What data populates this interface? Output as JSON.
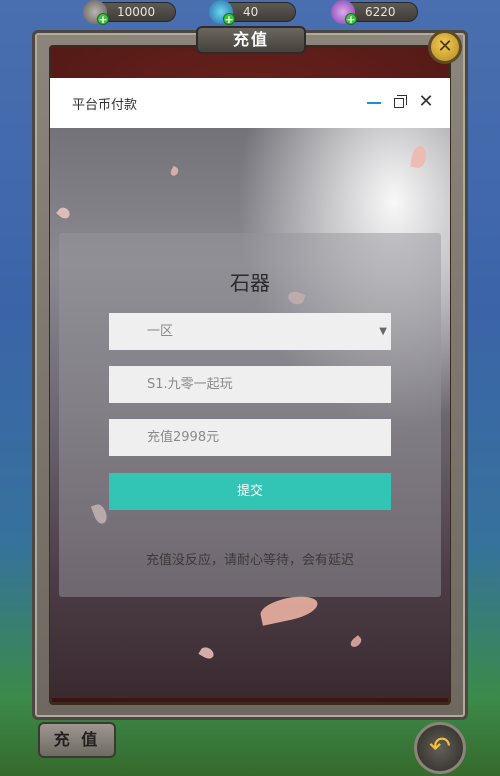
{
  "resources": {
    "gold": "10000",
    "gems": "40",
    "crystals": "6220"
  },
  "game": {
    "panel_title": "充值",
    "bottom_button": "充 值",
    "close_icon": "close-x-icon",
    "back_icon": "back-arrow-icon"
  },
  "dialog": {
    "title": "平台币付款",
    "card_title": "石器",
    "server_select": "一区",
    "role_field": "S1.九零一起玩",
    "amount_field": "充值2998元",
    "submit_label": "提交",
    "note": "充值没反应，请耐心等待，会有延迟"
  },
  "colors": {
    "accent": "#32c4b4",
    "minimize": "#1a8fd6"
  }
}
